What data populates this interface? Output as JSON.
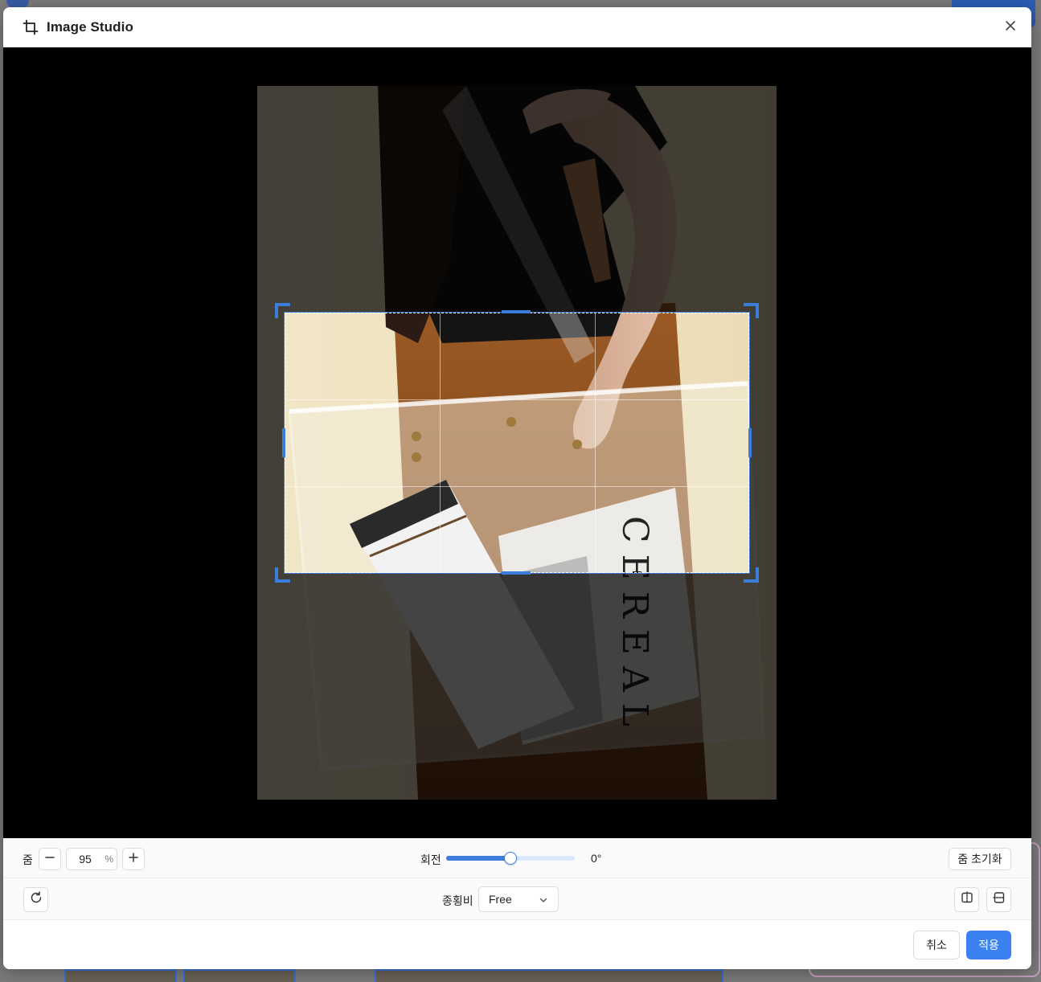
{
  "dialog": {
    "title": "Image Studio",
    "icon": "crop-icon",
    "close_icon": "close-icon"
  },
  "editor": {
    "image_subject": "CEREAL",
    "crop_active": true
  },
  "zoom": {
    "label": "줌",
    "value": "95",
    "unit": "%",
    "decrease_icon": "minus-icon",
    "increase_icon": "plus-icon",
    "reset_label": "줌 초기화"
  },
  "rotation": {
    "label": "회전",
    "value_text": "0°",
    "slider_fraction": 0.5
  },
  "tools": {
    "rotate_icon": "rotate-icon",
    "aspect_label": "종횡비",
    "aspect_value": "Free",
    "flip_horizontal_icon": "flip-horizontal-icon",
    "flip_vertical_icon": "flip-vertical-icon"
  },
  "footer": {
    "cancel_label": "취소",
    "apply_label": "적용"
  },
  "colors": {
    "accent": "#3b82f0",
    "crop_handle": "#3b7ddd"
  }
}
